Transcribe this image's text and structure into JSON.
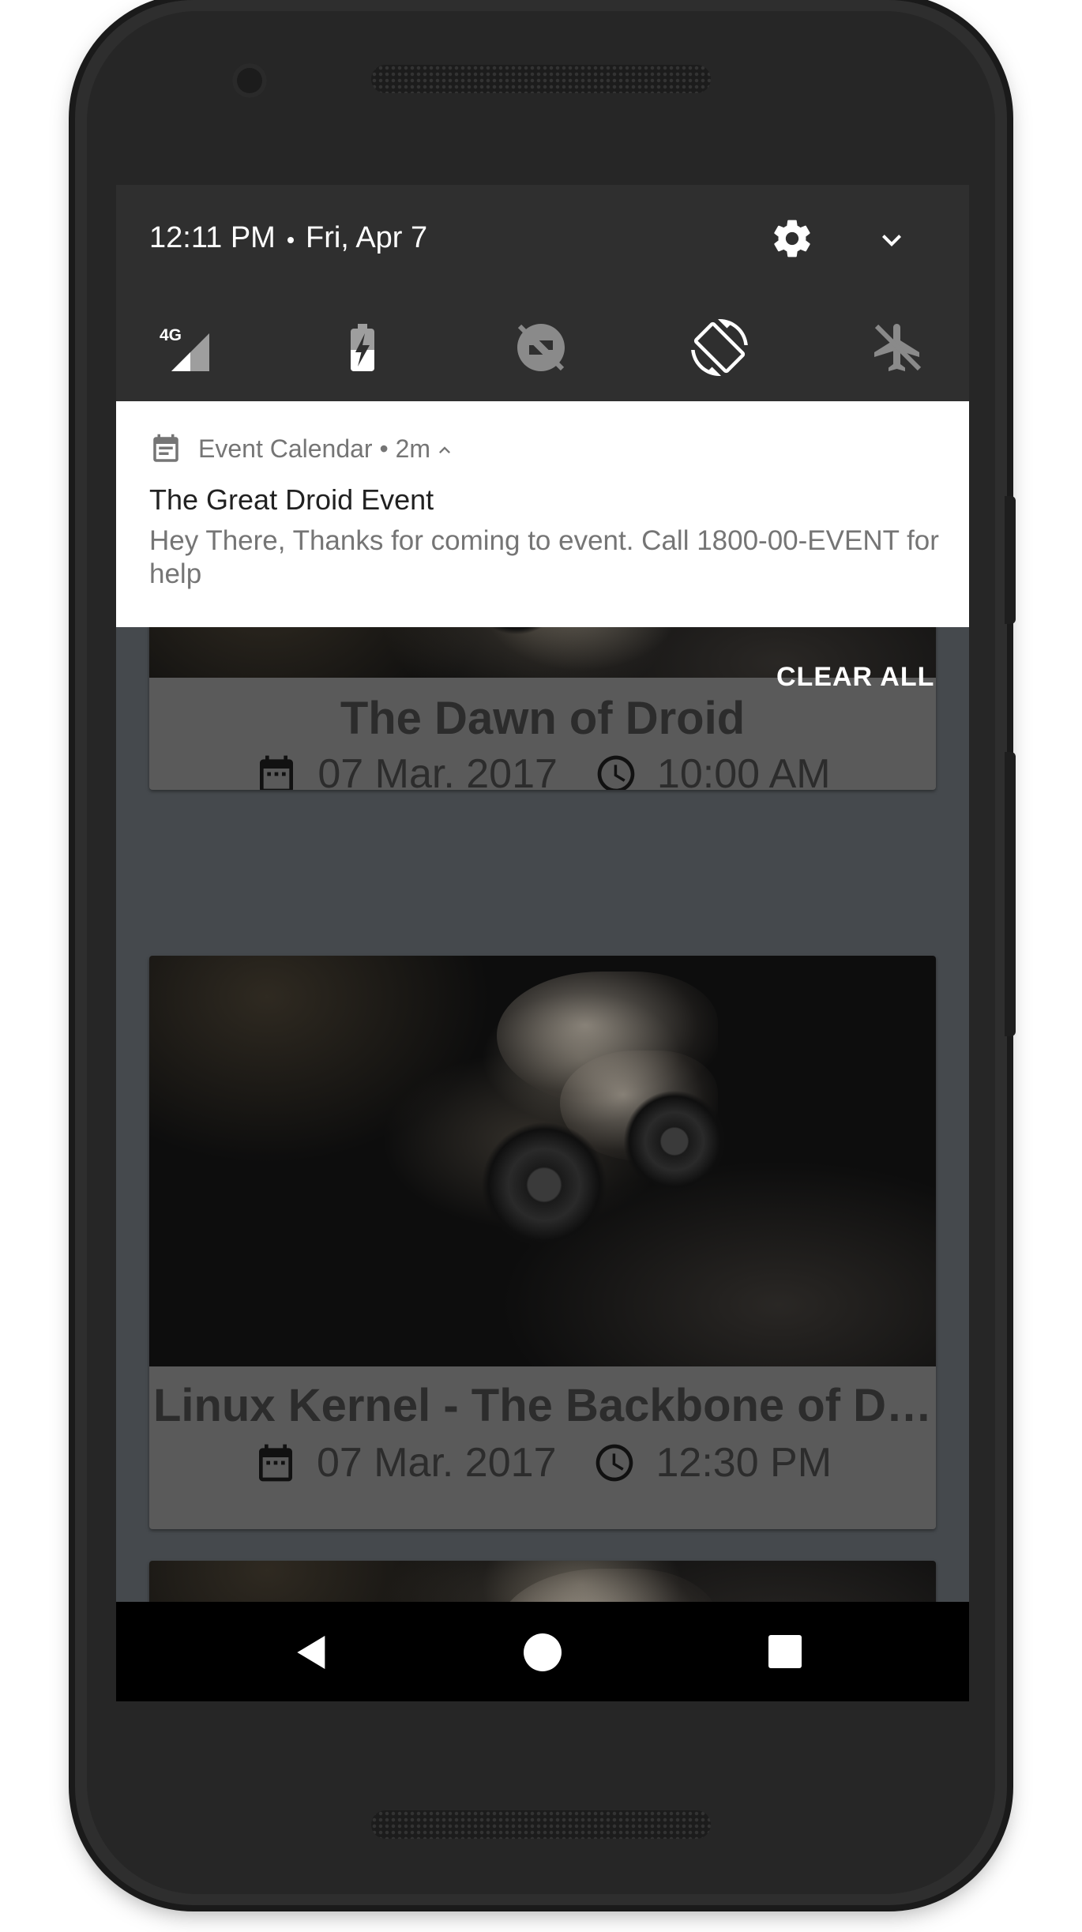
{
  "status_bar": {
    "time": "12:11 PM",
    "date": "Fri, Apr 7"
  },
  "quick_settings": {
    "tiles": [
      {
        "icon": "mobile-data-4g-icon",
        "label": "4G"
      },
      {
        "icon": "battery-saver-icon"
      },
      {
        "icon": "do-not-disturb-off-icon"
      },
      {
        "icon": "auto-rotate-icon"
      },
      {
        "icon": "airplane-mode-icon"
      }
    ]
  },
  "notification": {
    "app_name": "Event Calendar",
    "separator": "•",
    "age": "2m",
    "title": "The Great Droid Event",
    "body": "Hey There, Thanks for coming to event. Call 1800-00-EVENT for help"
  },
  "clear_all_label": "CLEAR ALL",
  "events": [
    {
      "title": "The Dawn of Droid",
      "date": "07 Mar. 2017",
      "time": "10:00 AM"
    },
    {
      "title": "Linux Kernel - The Backbone of D…",
      "date": "07 Mar. 2017",
      "time": "12:30 PM"
    }
  ],
  "colors": {
    "shade_header": "#2f2f2f",
    "notification_bg": "#ffffff",
    "scrim": "#45494d",
    "nav_bar": "#000000"
  }
}
